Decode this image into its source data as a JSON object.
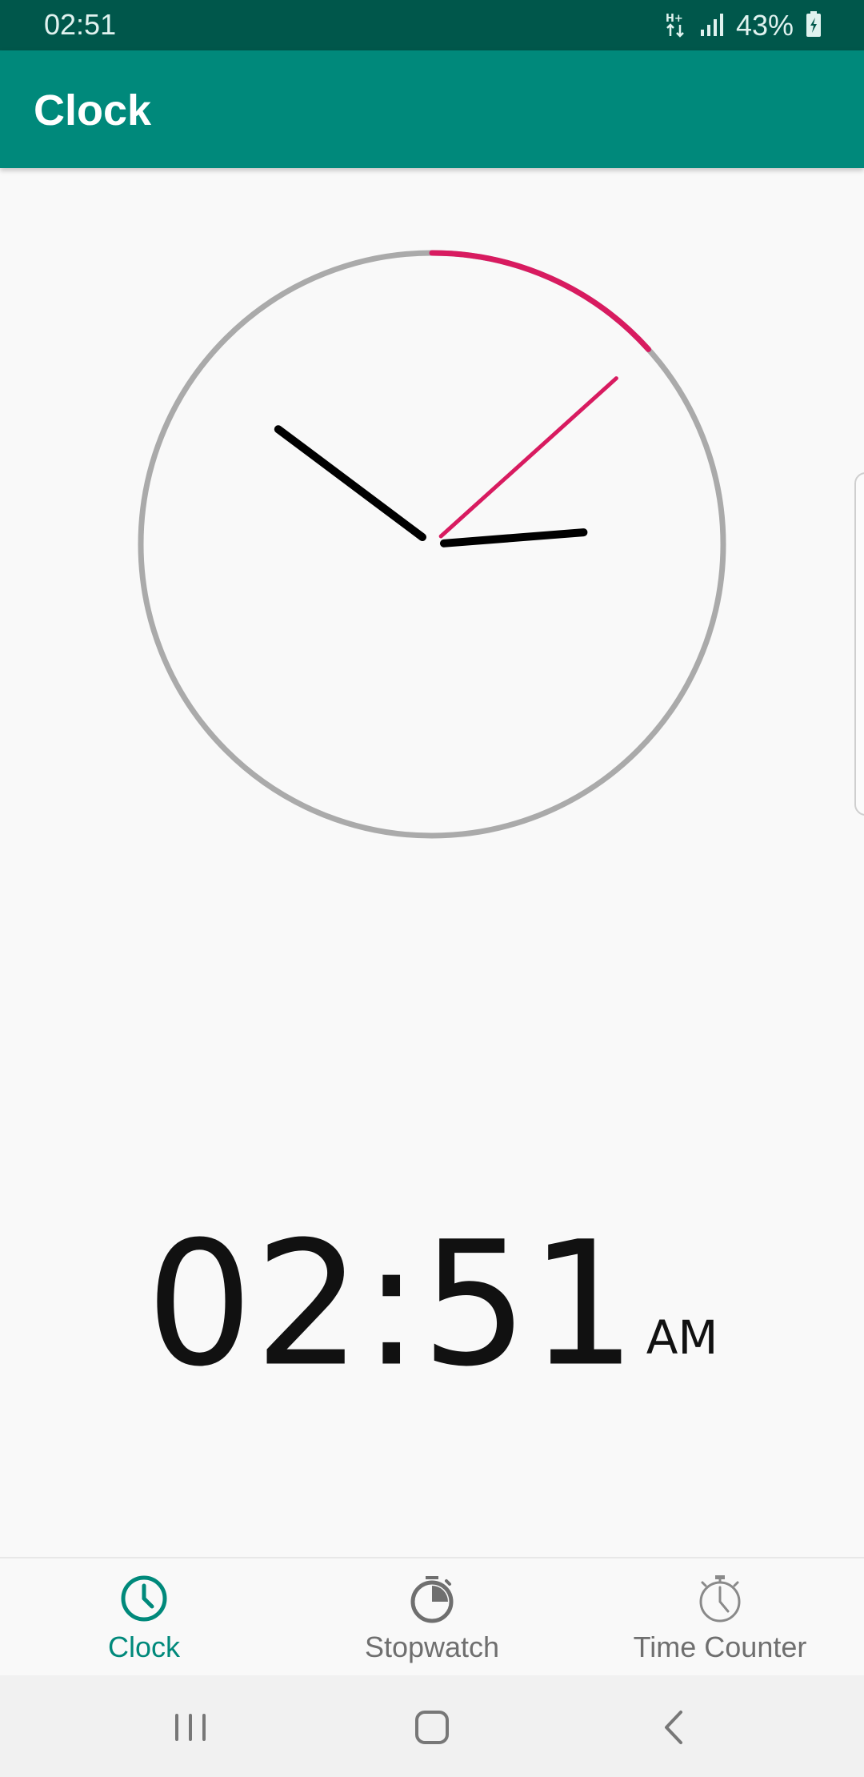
{
  "status_bar": {
    "time": "02:51",
    "network_icon": "data-transfer-icon",
    "signal_icon": "signal-icon",
    "battery_percent": "43%",
    "battery_icon": "battery-charging-icon"
  },
  "app_bar": {
    "title": "Clock"
  },
  "analog_clock": {
    "hour": 2,
    "minute": 51,
    "second": 8,
    "colors": {
      "ring": "#aaaaaa",
      "progress": "#d81b60",
      "hands": "#000000",
      "second_hand": "#d81b60"
    }
  },
  "digital_clock": {
    "time": "02:51",
    "ampm": "AM"
  },
  "bottom_nav": {
    "tabs": [
      {
        "label": "Clock",
        "icon": "clock-icon",
        "active": true
      },
      {
        "label": "Stopwatch",
        "icon": "stopwatch-icon",
        "active": false
      },
      {
        "label": "Time Counter",
        "icon": "timer-icon",
        "active": false
      }
    ]
  },
  "system_nav": {
    "recents_icon": "recents-icon",
    "home_icon": "home-icon",
    "back_icon": "back-icon"
  },
  "theme": {
    "primary": "#00897b",
    "primary_dark": "#00574b",
    "accent": "#d81b60"
  }
}
